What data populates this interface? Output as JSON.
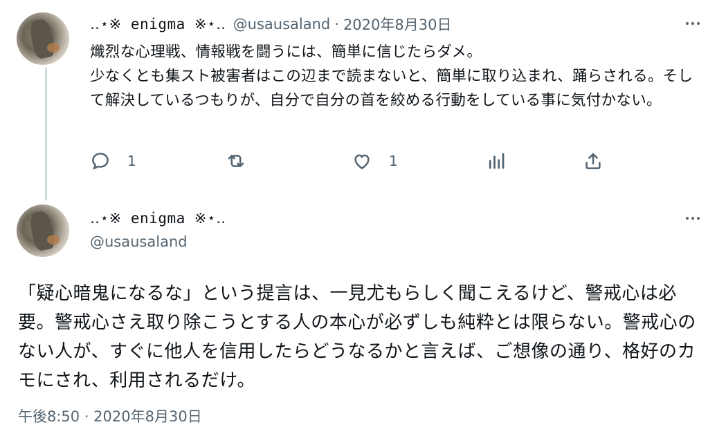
{
  "tweet1": {
    "display_name": "‥⋆※ enigma ※⋆‥",
    "handle": "@usausaland",
    "separator": "·",
    "date": "2020年8月30日",
    "text": "熾烈な心理戦、情報戦を闘うには、簡単に信じたらダメ。\n少なくとも集スト被害者はこの辺まで読まないと、簡単に取り込まれ、踊らされる。そして解決しているつもりが、自分で自分の首を絞める行動をしている事に気付かない。",
    "reply_count": "1",
    "like_count": "1"
  },
  "tweet2": {
    "display_name": "‥⋆※ enigma ※⋆‥",
    "handle": "@usausaland",
    "text": "「疑心暗鬼になるな」という提言は、一見尤もらしく聞こえるけど、警戒心は必要。警戒心さえ取り除こうとする人の本心が必ずしも純粋とは限らない。警戒心のない人が、すぐに他人を信用したらどうなるかと言えば、ご想像の通り、格好のカモにされ、利用されるだけ。",
    "timestamp": "午後8:50 · 2020年8月30日"
  },
  "icons": {
    "reply": "reply-icon",
    "retweet": "retweet-icon",
    "like": "heart-icon",
    "views": "analytics-icon",
    "share": "share-icon",
    "more": "more-icon"
  },
  "colors": {
    "text": "#0f1419",
    "muted": "#536471",
    "thread_line": "#cfd9de"
  }
}
